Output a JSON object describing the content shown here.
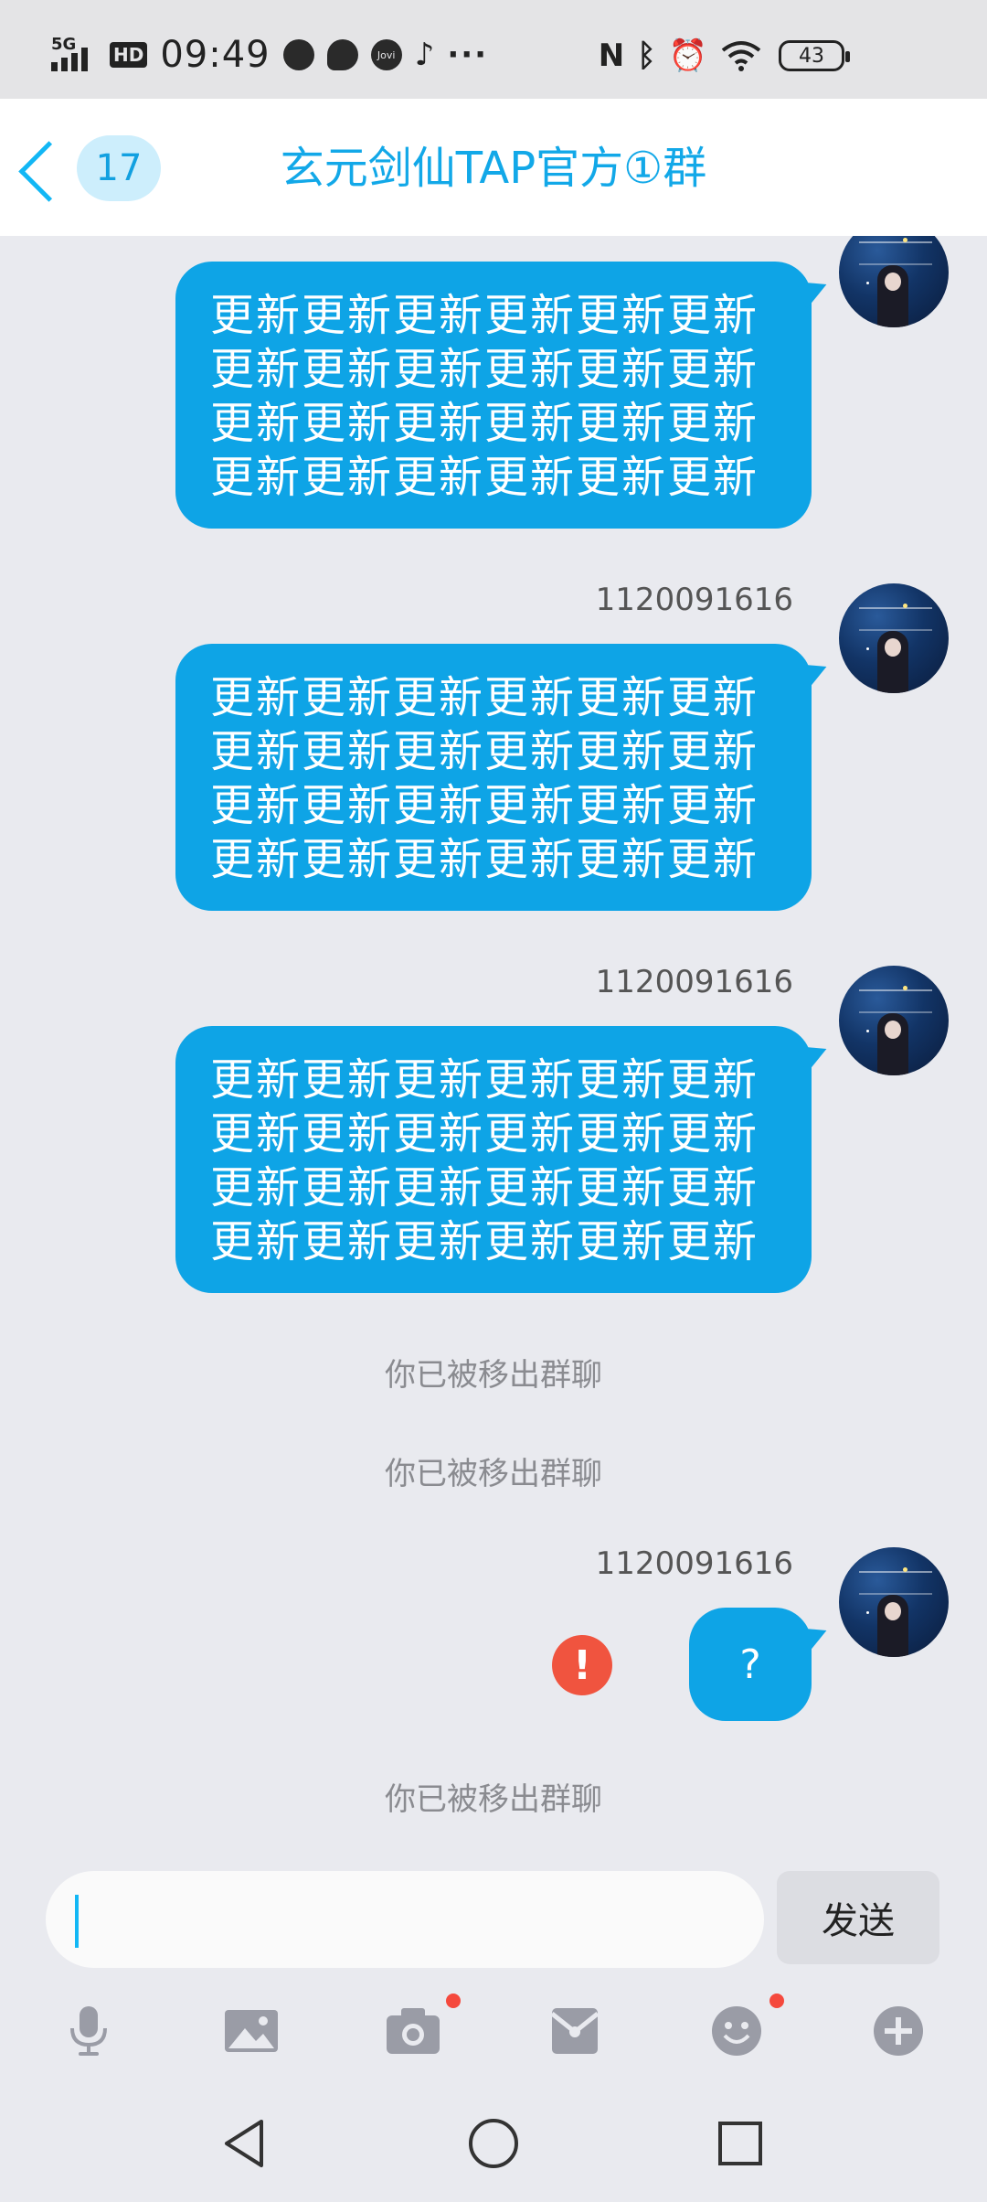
{
  "status_bar": {
    "network": "5G",
    "hd": "HD",
    "time": "09:49",
    "jovi": "Jovi",
    "more": "···",
    "battery": "43"
  },
  "header": {
    "back_icon": "chevron-left-icon",
    "unread_count": "17",
    "title": "玄元剑仙TAP官方①群"
  },
  "messages": [
    {
      "sender": "",
      "text": "更新更新更新更新更新更新更新更新更新更新更新更新更新更新更新更新更新更新更新更新更新更新更新更新"
    },
    {
      "sender": "1120091616",
      "text": "更新更新更新更新更新更新更新更新更新更新更新更新更新更新更新更新更新更新更新更新更新更新更新更新"
    },
    {
      "sender": "1120091616",
      "text": "更新更新更新更新更新更新更新更新更新更新更新更新更新更新更新更新更新更新更新更新更新更新更新更新"
    },
    {
      "sender": "1120091616",
      "text": "?"
    }
  ],
  "system_notices": [
    "你已被移出群聊",
    "你已被移出群聊",
    "你已被移出群聊"
  ],
  "error_icon": "!",
  "input": {
    "value": "",
    "placeholder": "",
    "send_label": "发送"
  },
  "toolbar": {
    "icons": [
      "microphone-icon",
      "image-icon",
      "camera-icon",
      "red-packet-icon",
      "emoji-icon",
      "plus-icon"
    ]
  },
  "nav": {
    "icons": [
      "back-triangle-icon",
      "home-circle-icon",
      "recents-square-icon"
    ]
  },
  "colors": {
    "accent": "#12b7f5",
    "bubble": "#0ea4e6",
    "error": "#f0543f",
    "background": "#e9eaef"
  }
}
